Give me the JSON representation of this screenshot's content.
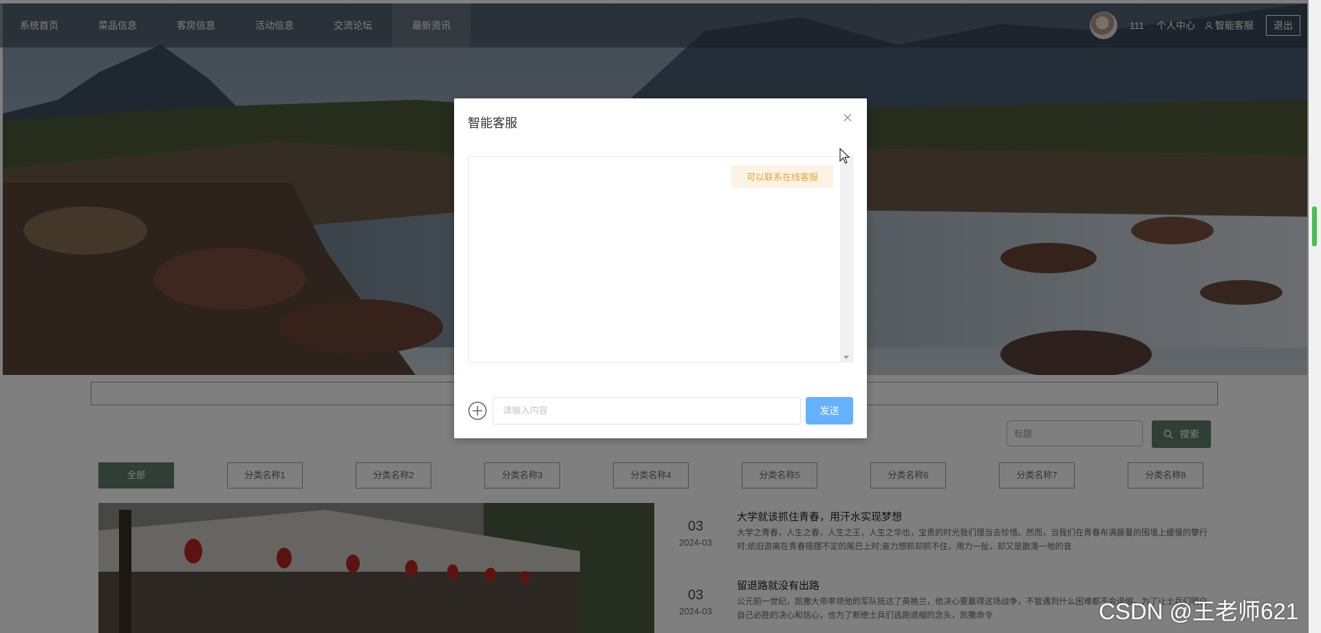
{
  "nav": {
    "items": [
      {
        "label": "系统首页"
      },
      {
        "label": "菜品信息"
      },
      {
        "label": "客房信息"
      },
      {
        "label": "活动信息"
      },
      {
        "label": "交流论坛"
      },
      {
        "label": "最新资讯"
      }
    ],
    "active_index": 5
  },
  "user": {
    "name": "111",
    "center_label": "个人中心",
    "service_label": "智能客服",
    "logout_label": "退出"
  },
  "filter": {
    "title_placeholder": "标题",
    "search_label": "搜索",
    "categories": [
      {
        "label": "全部"
      },
      {
        "label": "分类名称1"
      },
      {
        "label": "分类名称2"
      },
      {
        "label": "分类名称3"
      },
      {
        "label": "分类名称4"
      },
      {
        "label": "分类名称5"
      },
      {
        "label": "分类名称6"
      },
      {
        "label": "分类名称7"
      },
      {
        "label": "分类名称8"
      }
    ]
  },
  "news": [
    {
      "day": "03",
      "year_month": "2024-03",
      "title": "大学就该抓住青春，用汗水实现梦想",
      "desc": "大学之青春，人生之春，人生之王，人生之华也，宝贵的时光我们理当去珍惜。然而，当我们在青春布满藤蔓的围墙上缓慢的攀行时;依旧游离在青春摇摆不定的尾巴上时;奋力想抓却抓不住，用力一扯，却又是散落一地的音"
    },
    {
      "day": "03",
      "year_month": "2024-03",
      "title": "留退路就没有出路",
      "desc": "公元前一世纪，凯撒大帝率领他的军队抵达了英格兰，他决心要赢得这场战争，不管遇到什么困难都不会退缩。为了让士兵们明白自己必胜的决心和信心，也为了断绝士兵们逃跑退缩的念头，凯撒命令"
    }
  ],
  "dialog": {
    "title": "智能客服",
    "message": "可以联系在线客服",
    "input_placeholder": "请输入内容",
    "send_label": "发送"
  },
  "watermark": "CSDN @王老师621",
  "colors": {
    "accent": "#5f7f70",
    "send_button": "#66b1ff",
    "bubble_bg": "#fdf3e4",
    "bubble_text": "#e6a23c"
  }
}
